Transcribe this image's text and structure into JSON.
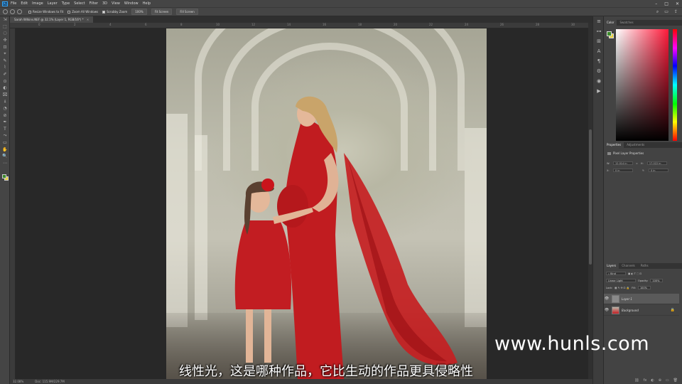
{
  "app": {
    "logo_text": "Ps"
  },
  "menu": [
    "File",
    "Edit",
    "Image",
    "Layer",
    "Type",
    "Select",
    "Filter",
    "3D",
    "View",
    "Window",
    "Help"
  ],
  "window_controls": [
    "–",
    "□",
    "✕"
  ],
  "options_bar": {
    "checks": [
      {
        "label": "Resize Windows to Fit",
        "checked": false
      },
      {
        "label": "Zoom All Windows",
        "checked": false
      },
      {
        "label": "Scrubby Zoom",
        "checked": true
      }
    ],
    "zoom_value": "100%",
    "fit_screen": "Fit Screen",
    "fill_screen": "Fill Screen"
  },
  "document_tab": {
    "title": "Sarah Wilkins.NEF @ 32.1% (Layer 1, RGB/16*) *",
    "close": "×"
  },
  "ruler_ticks": [
    "0",
    "2",
    "4",
    "6",
    "8",
    "10",
    "12",
    "14",
    "16",
    "18",
    "20",
    "22",
    "24",
    "26",
    "28",
    "30"
  ],
  "status": {
    "zoom": "32.08%",
    "doc": "Doc: 115.9M/229.7M"
  },
  "tools": [
    "⇲",
    "⬚",
    "◌",
    "✣",
    "⊡",
    "⌖",
    "✎",
    "⌇",
    "✐",
    "⊙",
    "◐",
    "⌧",
    "⍋",
    "◔",
    "⊘",
    "✒",
    "T",
    "⤳",
    "▭",
    "✋",
    "🔍",
    "⋯"
  ],
  "icon_strip": [
    "≡",
    "⊶",
    "⊞",
    "A",
    "¶",
    "⚙",
    "◉",
    "▶"
  ],
  "color_panel": {
    "tabs": [
      "Color",
      "Swatches"
    ],
    "fg_color": "#3d8a2b",
    "bg_color": "#e6d03a"
  },
  "properties_panel": {
    "tabs": [
      "Properties",
      "Adjustments"
    ],
    "title": "Pixel Layer Properties",
    "fields": [
      {
        "label": "W:",
        "value": "12.014 in",
        "label2": "H:",
        "value2": "17.022 in"
      },
      {
        "label": "X:",
        "value": "0 in",
        "label2": "Y:",
        "value2": "0 in"
      }
    ]
  },
  "layers_panel": {
    "tabs": [
      "Layers",
      "Channels",
      "Paths"
    ],
    "kind_filter": "Kind",
    "blend_mode": "Linear Light",
    "opacity_label": "Opacity:",
    "opacity": "100%",
    "lock_label": "Lock:",
    "fill_label": "Fill:",
    "fill": "100%",
    "layers": [
      {
        "name": "Layer 1",
        "visible": true,
        "selected": true,
        "locked": false
      },
      {
        "name": "Background",
        "visible": true,
        "selected": false,
        "locked": true
      }
    ],
    "footer_icons": [
      "⛓",
      "fx",
      "◐",
      "⊕",
      "▭",
      "🗑"
    ]
  },
  "watermark": "www.hunls.com",
  "subtitle": "线性光，这是哪种作品，它比生动的作品更具侵略性"
}
